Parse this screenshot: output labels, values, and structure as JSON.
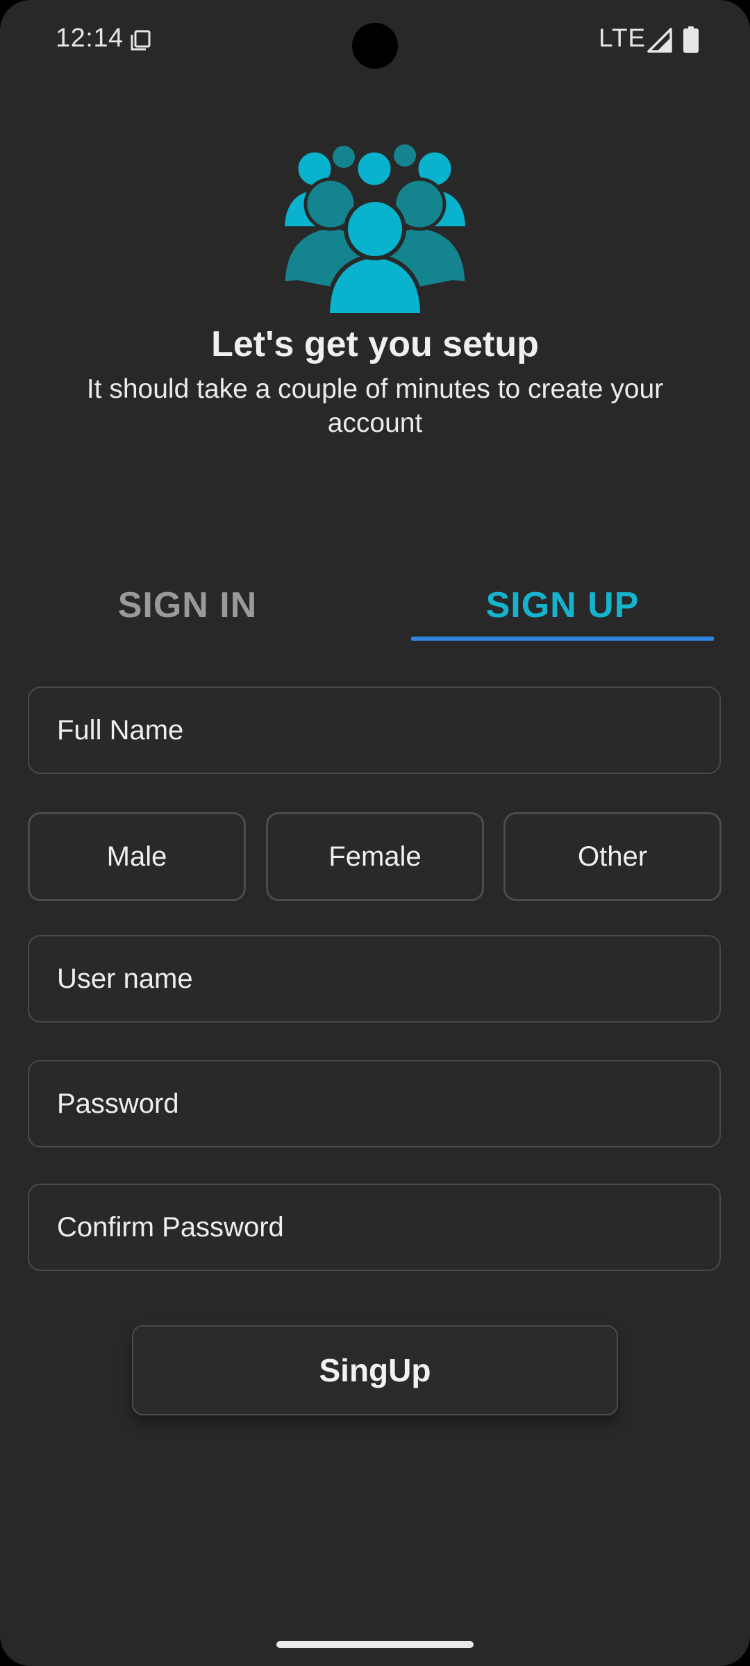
{
  "status_bar": {
    "time": "12:14",
    "network": "LTE"
  },
  "header": {
    "icon": "people-group-icon",
    "title": "Let's get you setup",
    "subtitle": "It should take a couple of minutes to create your account"
  },
  "tabs": [
    {
      "label": "SIGN IN",
      "selected": false
    },
    {
      "label": "SIGN UP",
      "selected": true
    }
  ],
  "form": {
    "full_name_placeholder": "Full Name",
    "gender_options": [
      "Male",
      "Female",
      "Other"
    ],
    "username_placeholder": "User name",
    "password_placeholder": "Password",
    "confirm_password_placeholder": "Confirm Password",
    "submit_label": "SingUp"
  },
  "colors": {
    "background": "#282828",
    "accent": "#16b3cf",
    "tab_indicator": "#2f86e0",
    "icon_teal": "#09b3cd",
    "icon_teal_dark": "#14848f"
  }
}
